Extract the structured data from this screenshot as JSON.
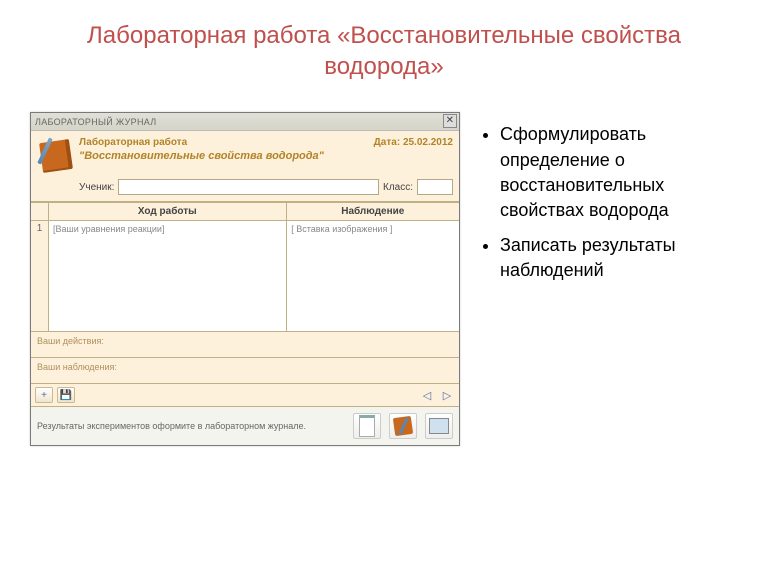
{
  "slide": {
    "title": "Лабораторная работа \n«Восстановительные свойства водорода»",
    "bullets": [
      "Сформулировать определение о восстановительных свойствах водорода",
      "Записать результаты наблюдений"
    ]
  },
  "journal": {
    "window_title": "ЛАБОРАТОРНЫЙ ЖУРНАЛ",
    "header_label": "Лабораторная работа",
    "work_title": "\"Восстановительные свойства водорода\"",
    "date_label": "Дата:",
    "date_value": "25.02.2012",
    "student_label": "Ученик:",
    "class_label": "Класс:",
    "table": {
      "col1": "Ход работы",
      "col2": "Наблюдение",
      "row_num": "1",
      "cell1_placeholder": "[Ваши уравнения реакции]",
      "cell2_placeholder": "[ Вставка изображения ]"
    },
    "lower": {
      "actions": "Ваши действия:",
      "observations": "Ваши наблюдения:"
    },
    "toolbar": {
      "add": "+",
      "save": "💾",
      "prev": "◁",
      "next": "▷"
    },
    "footer_text": "Результаты экспериментов оформите в лабораторном журнале."
  }
}
